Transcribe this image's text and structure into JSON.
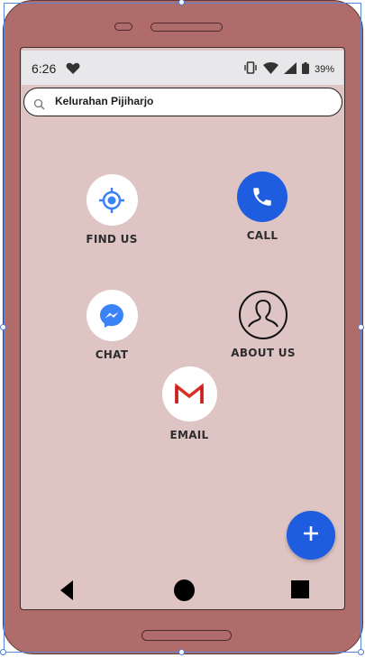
{
  "status_bar": {
    "time": "6:26",
    "battery_percent": "39%",
    "icons": [
      "heart-icon",
      "vibrate-icon",
      "wifi-icon",
      "signal-icon",
      "battery-icon"
    ]
  },
  "search": {
    "value": "Kelurahan Pijiharjo"
  },
  "menu": {
    "find_us": "FIND US",
    "call": "CALL",
    "chat": "CHAT",
    "about_us": "ABOUT US",
    "email": "EMAIL"
  },
  "colors": {
    "phone_body": "#b06b6b",
    "screen_background": "#dfc4c4",
    "accent_blue": "#1e5ce0",
    "location_blue": "#3b82f6",
    "gmail_red": "#d93025"
  },
  "nav_bar": {
    "icons": [
      "back-icon",
      "home-icon",
      "recent-apps-icon"
    ]
  },
  "fab": {
    "icon": "plus-icon"
  }
}
